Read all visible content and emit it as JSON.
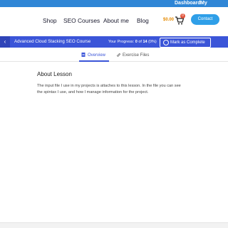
{
  "topbar": {
    "dashboard": "Dashboard",
    "account": "My Account"
  },
  "nav": {
    "links": [
      "Shop",
      "SEO Courses",
      "About me",
      "Blog"
    ],
    "cart_price": "$0.00",
    "cart_count": "0",
    "contact": "Contact"
  },
  "course": {
    "title": "Advanced Cloud Stacking SEO Course",
    "progress_label": "Your Progress:",
    "progress_current": "0",
    "progress_of": "of",
    "progress_total": "14",
    "progress_percent": "(0%)",
    "mark_complete": "Mark as Complete"
  },
  "tabs": [
    {
      "label": "Overview",
      "icon": "document-icon",
      "active": true
    },
    {
      "label": "Exercise Files",
      "icon": "paperclip-icon",
      "active": false
    }
  ],
  "lesson": {
    "title": "About Lesson",
    "body": "The input file I use in my projects is attaches to this lesson. In the file you can see the spintax I use, and how I manage information for the project."
  },
  "colors": {
    "primary": "#3b55d8",
    "topbar": "#2f86d6",
    "contact": "#2f9fe8",
    "price": "#e58a00"
  }
}
